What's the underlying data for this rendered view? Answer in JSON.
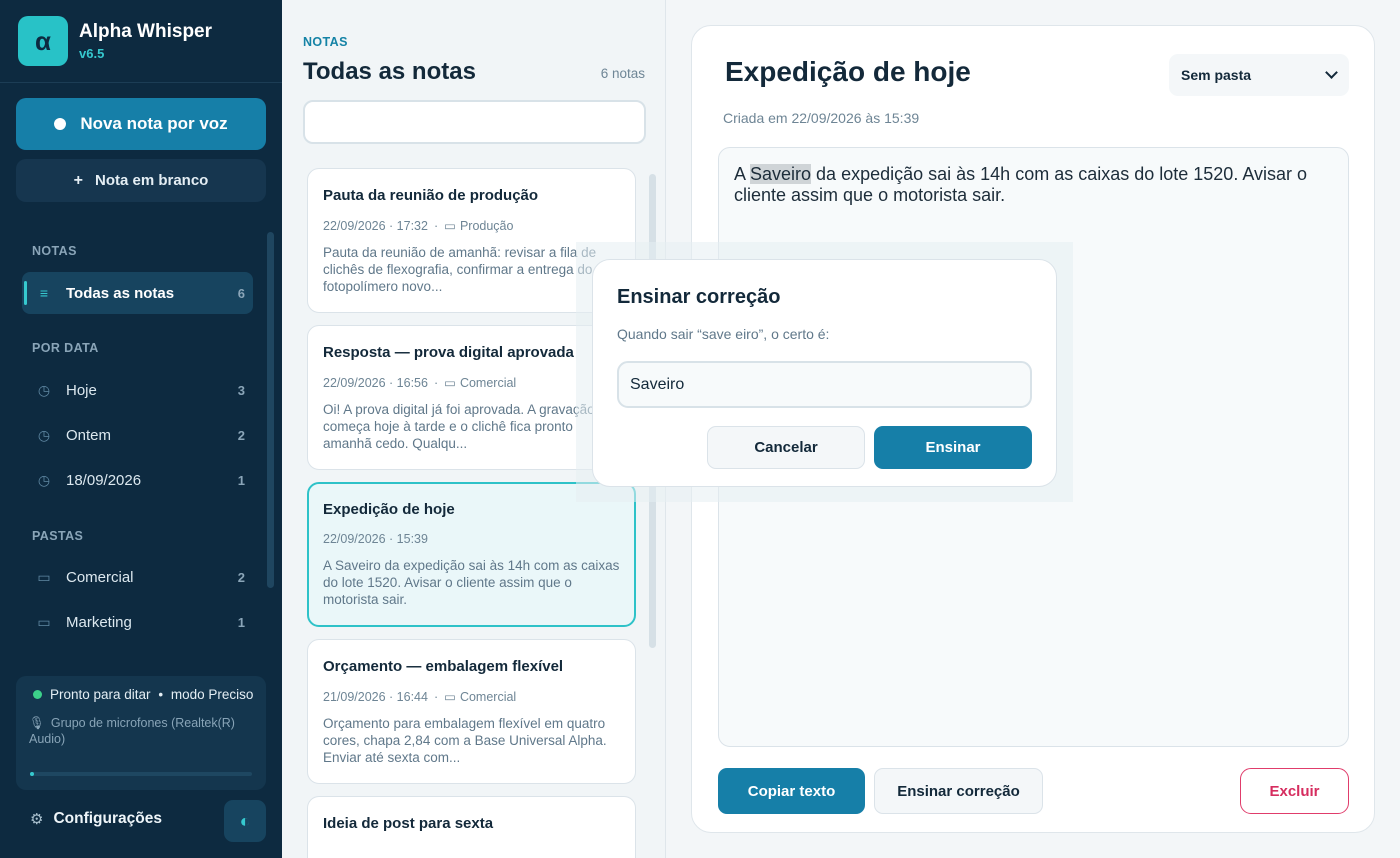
{
  "app": {
    "name": "Alpha Whisper",
    "version": "v6.5",
    "logo_glyph": "α"
  },
  "sidebar": {
    "new_voice_label": "Nova nota por voz",
    "new_blank_label": "Nota em branco",
    "new_blank_icon": "+",
    "sections": {
      "notes": "NOTAS",
      "by_date": "POR DATA",
      "folders": "PASTAS"
    },
    "notes_items": [
      {
        "icon": "list-icon",
        "label": "Todas as notas",
        "count": "6",
        "active": true
      }
    ],
    "date_items": [
      {
        "icon": "clock-icon",
        "label": "Hoje",
        "count": "3"
      },
      {
        "icon": "clock-icon",
        "label": "Ontem",
        "count": "2"
      },
      {
        "icon": "clock-icon",
        "label": "18/09/2026",
        "count": "1"
      }
    ],
    "folder_items": [
      {
        "icon": "folder-icon",
        "label": "Comercial",
        "count": "2"
      },
      {
        "icon": "folder-icon",
        "label": "Marketing",
        "count": "1"
      }
    ],
    "status": {
      "ready": "Pronto para ditar",
      "bullet": "•",
      "mode": "modo",
      "mode_value": "Preciso",
      "microphone": "Grupo de microfones (Realtek(R) Audio)",
      "level": 0.02
    },
    "settings_label": "Configurações"
  },
  "list": {
    "eyebrow": "NOTAS",
    "title": "Todas as notas",
    "count": "6 notas",
    "search_value": "",
    "notes": [
      {
        "title": "Pauta da reunião de produção",
        "date": "22/09/2026 · 17:32",
        "sep": "·",
        "folder": "Produção",
        "preview": "Pauta da reunião de amanhã: revisar a fila de clichês de flexografia, confirmar a entrega do fotopolímero novo..."
      },
      {
        "title": "Resposta — prova digital aprovada",
        "date": "22/09/2026 · 16:56",
        "sep": "·",
        "folder": "Comercial",
        "preview": "Oi! A prova digital já foi aprovada. A gravação começa hoje à tarde e o clichê fica pronto amanhã cedo. Qualqu..."
      },
      {
        "title": "Expedição de hoje",
        "date": "22/09/2026 · 15:39",
        "sep": "",
        "folder": "",
        "preview": "A Saveiro da expedição sai às 14h com as caixas do lote 1520. Avisar o cliente assim que o motorista sair.",
        "selected": true
      },
      {
        "title": "Orçamento — embalagem flexível",
        "date": "21/09/2026 · 16:44",
        "sep": "·",
        "folder": "Comercial",
        "preview": "Orçamento para embalagem flexível em quatro cores, chapa 2,84 com a Base Universal Alpha. Enviar até sexta com..."
      },
      {
        "title": "Ideia de post para sexta",
        "date": "",
        "sep": "",
        "folder": "",
        "preview": ""
      }
    ]
  },
  "editor": {
    "title": "Expedição de hoje",
    "folder_select": "Sem pasta",
    "created": "Criada em 22/09/2026 às 15:39",
    "body_before": "A ",
    "body_highlight": "Saveiro",
    "body_after": " da expedição sai às 14h com as caixas do lote 1520. Avisar o cliente assim que o motorista sair.",
    "copy_label": "Copiar texto",
    "teach_label": "Ensinar correção",
    "delete_label": "Excluir"
  },
  "dialog": {
    "title": "Ensinar correção",
    "subtitle": "Quando sair “save eiro”, o certo é:",
    "input_value": "Saveiro",
    "cancel_label": "Cancelar",
    "confirm_label": "Ensinar"
  },
  "colors": {
    "sidebar_bg": "#0d2a40",
    "accent": "#167fa8",
    "teal": "#28c2c7",
    "danger": "#d62d5f",
    "status_green": "#3cd18a"
  }
}
